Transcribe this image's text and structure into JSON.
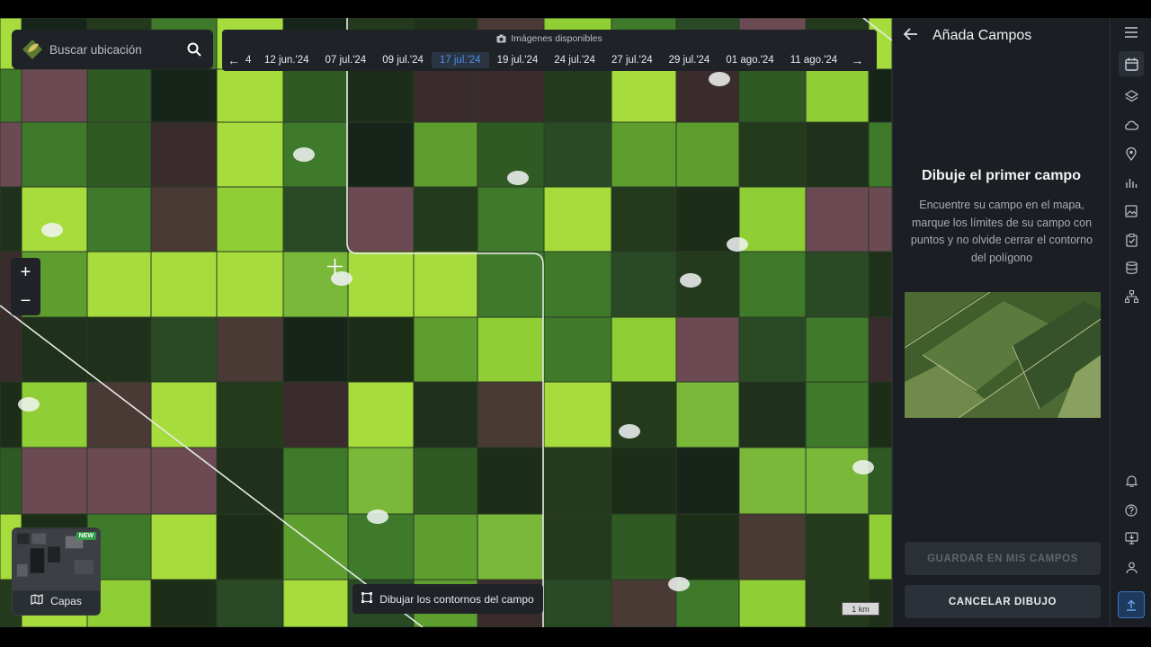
{
  "search": {
    "placeholder": "Buscar ubicación"
  },
  "timeline": {
    "header": "Imágenes disponibles",
    "partial_date": "4",
    "dates": [
      "12 jun.'24",
      "07 jul.'24",
      "09 jul.'24",
      "17 jul.'24",
      "19 jul.'24",
      "24 jul.'24",
      "27 jul.'24",
      "29 jul.'24",
      "01 ago.'24",
      "11 ago.'24"
    ],
    "selected": "17 jul.'24"
  },
  "zoom": {
    "in": "+",
    "out": "−"
  },
  "layers": {
    "label": "Capas",
    "badge": "NEW"
  },
  "draw": {
    "label": "Dibujar los contornos del campo"
  },
  "scale": {
    "label": "1 km"
  },
  "panel": {
    "title": "Añada Campos",
    "heading": "Dibuje el primer campo",
    "description": "Encuentre su campo en el mapa, marque los límites de su campo con puntos y no olvide cerrar el contorno del polígono",
    "save_button": "GUARDAR EN MIS CAMPOS",
    "cancel_button": "CANCELAR DIBUJO"
  },
  "rail": {
    "icons": [
      "menu-icon",
      "calendar-icon",
      "layers-icon",
      "cloud-icon",
      "location-pin-icon",
      "bar-chart-icon",
      "image-icon",
      "task-icon",
      "database-icon",
      "hierarchy-icon",
      "bell-icon",
      "help-icon",
      "monitor-icon",
      "user-icon",
      "upload-icon"
    ]
  },
  "colors": {
    "accent": "#4b8fe8",
    "panel_bg": "#1b1f24",
    "field_bright": "#9ed83a"
  }
}
